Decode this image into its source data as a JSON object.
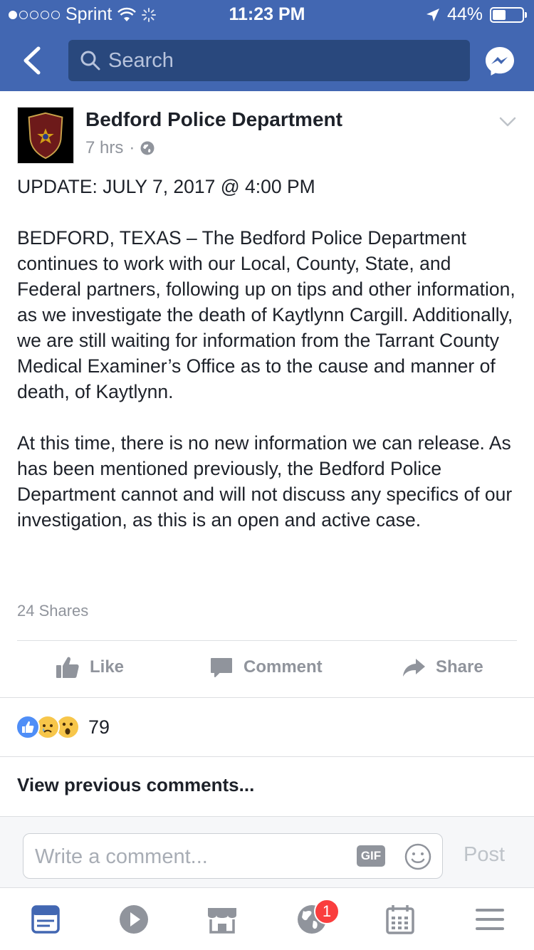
{
  "status_bar": {
    "carrier": "Sprint",
    "time": "11:23 PM",
    "battery": "44%",
    "battery_level": 0.44
  },
  "header": {
    "search_placeholder": "Search"
  },
  "post": {
    "page_name": "Bedford Police Department",
    "timestamp": "7 hrs",
    "meta_separator": "·",
    "paragraphs": [
      "UPDATE:  JULY 7, 2017 @ 4:00 PM",
      "BEDFORD, TEXAS – The Bedford Police Department continues to work with our Local, County, State, and Federal partners, following up on tips and other information, as we investigate the death of Kaytlynn Cargill.  Additionally, we are still waiting for information from the Tarrant County Medical Examiner’s Office as to the cause and manner of death, of Kaytlynn.",
      "At this time, there is no new information we can release. As has been mentioned previously, the Bedford Police Department cannot and will not discuss any specifics of our investigation, as this is an open and active case."
    ],
    "shares": "24 Shares"
  },
  "actions": {
    "like": "Like",
    "comment": "Comment",
    "share": "Share"
  },
  "reactions": {
    "count": "79",
    "types": [
      "like",
      "sad",
      "wow"
    ]
  },
  "comments": {
    "view_previous": "View previous comments..."
  },
  "composer": {
    "placeholder": "Write a comment...",
    "gif_label": "GIF",
    "post_label": "Post"
  },
  "tabbar": {
    "notifications_badge": "1"
  },
  "colors": {
    "brand": "#4267b2",
    "search_bg": "#29487d",
    "badge": "#fa3e3e",
    "muted": "#90949c"
  }
}
